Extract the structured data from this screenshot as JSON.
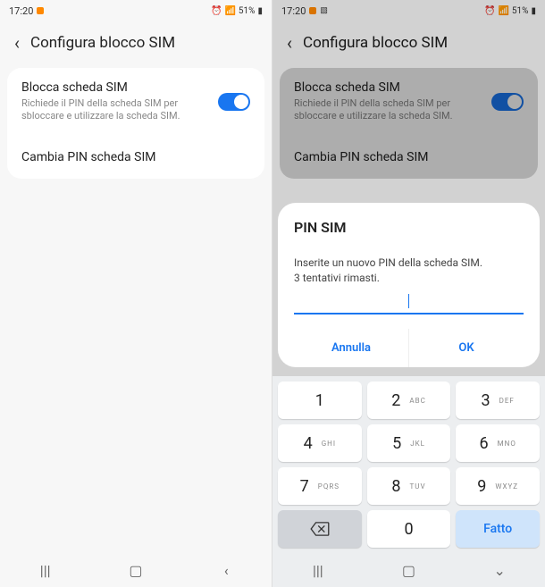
{
  "status": {
    "time": "17:20",
    "battery": "51%",
    "icons": "⏰ ⚡ 📶"
  },
  "header": {
    "title": "Configura blocco SIM"
  },
  "settings": {
    "block": {
      "title": "Blocca scheda SIM",
      "desc": "Richiede il PIN della scheda SIM per sbloccare e utilizzare la scheda SIM."
    },
    "changePin": "Cambia PIN scheda SIM"
  },
  "dialog": {
    "title": "PIN SIM",
    "message": "Inserite un nuovo PIN della scheda SIM.",
    "attempts": "3 tentativi rimasti.",
    "cancel": "Annulla",
    "ok": "OK"
  },
  "keypad": {
    "k1": "1",
    "k2": "2",
    "k3": "3",
    "k4": "4",
    "k5": "5",
    "k6": "6",
    "k7": "7",
    "k8": "8",
    "k9": "9",
    "k0": "0",
    "l2": "ABC",
    "l3": "DEF",
    "l4": "GHI",
    "l5": "JKL",
    "l6": "MNO",
    "l7": "PQRS",
    "l8": "TUV",
    "l9": "WXYZ",
    "done": "Fatto"
  }
}
